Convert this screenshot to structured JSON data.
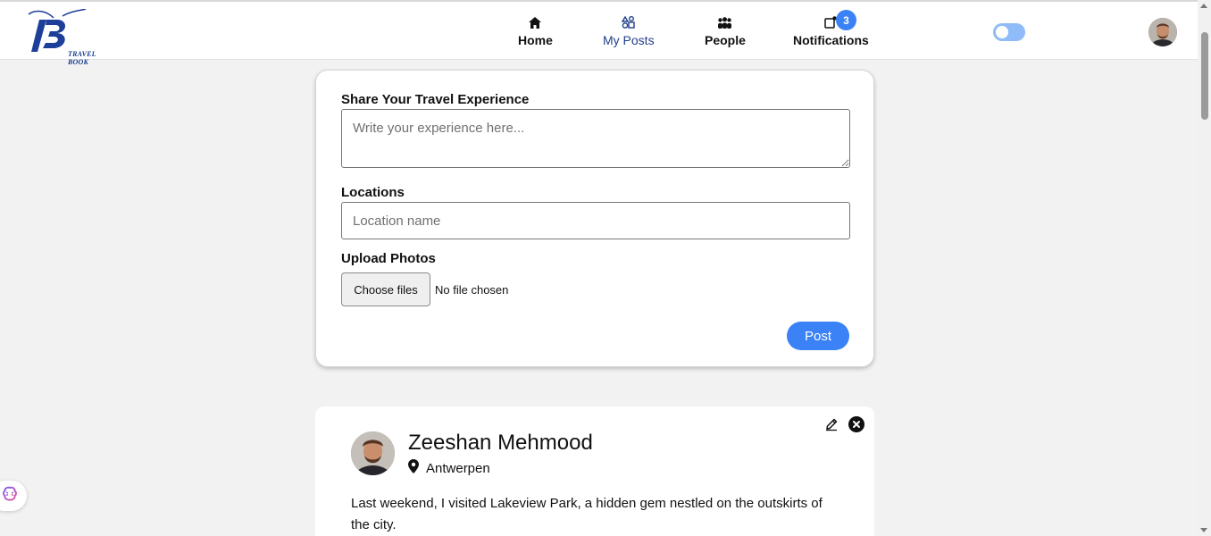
{
  "header": {
    "logo_text": "TRAVEL BOOK",
    "nav": [
      {
        "label": "Home",
        "icon": "home-icon"
      },
      {
        "label": "My Posts",
        "icon": "shapes-icon",
        "active": true
      },
      {
        "label": "People",
        "icon": "people-icon"
      },
      {
        "label": "Notifications",
        "icon": "notification-icon"
      }
    ],
    "notifications_count": "3",
    "accent_color": "#3b82f6",
    "theme_toggle": "off"
  },
  "form": {
    "experience_label": "Share Your Travel Experience",
    "experience_placeholder": "Write your experience here...",
    "location_label": "Locations",
    "location_placeholder": "Location name",
    "photos_label": "Upload Photos",
    "choose_files_label": "Choose files",
    "file_status": "No file chosen",
    "post_label": "Post"
  },
  "posts": [
    {
      "author": "Zeeshan Mehmood",
      "location": "Antwerpen",
      "text": "Last weekend, I visited Lakeview Park, a hidden gem nestled on the outskirts of the city."
    }
  ]
}
